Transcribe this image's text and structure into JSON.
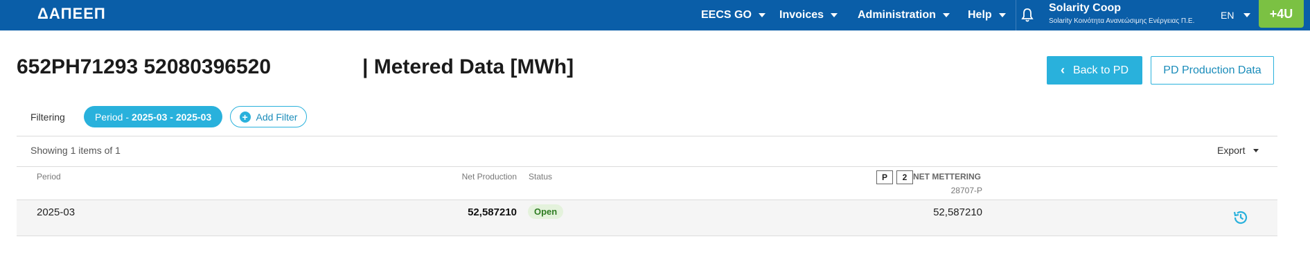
{
  "header": {
    "logo": "ΔΑΠΕΕΠ",
    "nav": [
      {
        "label": "EECS GO"
      },
      {
        "label": "Invoices"
      },
      {
        "label": "Administration"
      },
      {
        "label": "Help"
      }
    ],
    "user": {
      "name": "Solarity Coop",
      "org": "Solarity Κοινότητα Ανανεώσιμης Ενέργειας Π.Ε."
    },
    "language": "EN",
    "badge": "+4U"
  },
  "page": {
    "title_prefix": "652PH71293 52080396520",
    "title_suffix": "| Metered Data [MWh]",
    "back_button": "Back to PD",
    "pd_button": "PD Production Data"
  },
  "filters": {
    "label": "Filtering",
    "period_chip_label": "Period -",
    "period_chip_value": "2025-03 - 2025-03",
    "add_filter": "Add Filter"
  },
  "table": {
    "showing": "Showing 1 items of 1",
    "export": "Export",
    "columns": {
      "period": "Period",
      "net_production": "Net Production",
      "status": "Status",
      "box_p": "P",
      "box_2": "2",
      "net_metering": "NET METTERING",
      "net_metering_id": "28707-P"
    },
    "rows": [
      {
        "period": "2025-03",
        "net_production": "52,587210",
        "status": "Open",
        "net_metering": "52,587210"
      }
    ]
  },
  "colors": {
    "header_bg": "#0a5ea8",
    "accent": "#29b1dc",
    "badge_green": "#7bc143",
    "status_open_bg": "#e4f2dc",
    "status_open_text": "#2f7d23"
  }
}
